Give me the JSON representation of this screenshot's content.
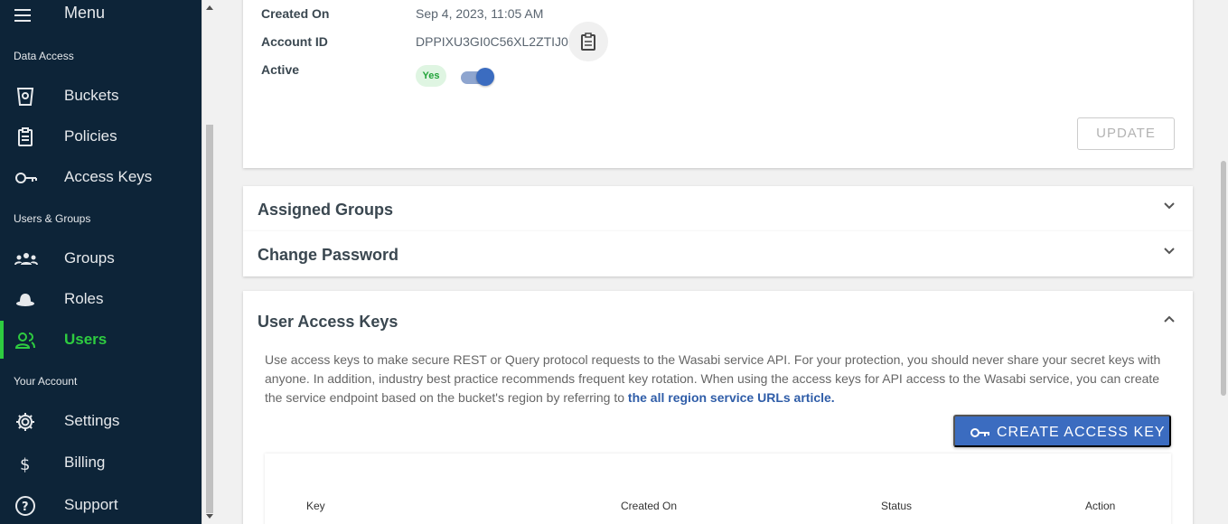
{
  "sidebar": {
    "menu_label": "Menu",
    "sections": {
      "data_access": "Data Access",
      "users_groups": "Users & Groups",
      "your_account": "Your Account"
    },
    "items": [
      {
        "label": "Buckets",
        "icon": "bucket-icon"
      },
      {
        "label": "Policies",
        "icon": "clipboard-icon"
      },
      {
        "label": "Access Keys",
        "icon": "key-icon"
      },
      {
        "label": "Groups",
        "icon": "groups-icon"
      },
      {
        "label": "Roles",
        "icon": "hat-icon"
      },
      {
        "label": "Users",
        "icon": "users-icon",
        "active": true
      },
      {
        "label": "Settings",
        "icon": "gear-icon"
      },
      {
        "label": "Billing",
        "icon": "dollar-icon"
      },
      {
        "label": "Support",
        "icon": "help-icon"
      }
    ],
    "active_color": "#2ecc40"
  },
  "details": {
    "created_on_label": "Created On",
    "created_on_value": "Sep 4, 2023, 11:05 AM",
    "account_id_label": "Account ID",
    "account_id_value": "DPPIXU3GI0C56XL2ZTIJ0",
    "active_label": "Active",
    "active_badge": "Yes",
    "active_toggle_on": true,
    "update_label": "UPDATE"
  },
  "accordions": {
    "assigned_groups": "Assigned Groups",
    "change_password": "Change Password"
  },
  "access_keys": {
    "title": "User Access Keys",
    "description": "Use access keys to make secure REST or Query protocol requests to the Wasabi service API. For your protection, you should never share your secret keys with anyone. In addition, industry best practice recommends frequent key rotation. When using the access keys for API access to the Wasabi service, you can create the service endpoint based on the bucket's region by referring to",
    "link_text": "the all region service URLs article.",
    "create_label": "CREATE ACCESS KEY",
    "columns": [
      "Key",
      "Created On",
      "Status",
      "Action"
    ]
  },
  "colors": {
    "sidebar_bg": "#0d2438",
    "primary": "#3b6cc0",
    "badge_green": "#22a33a"
  }
}
